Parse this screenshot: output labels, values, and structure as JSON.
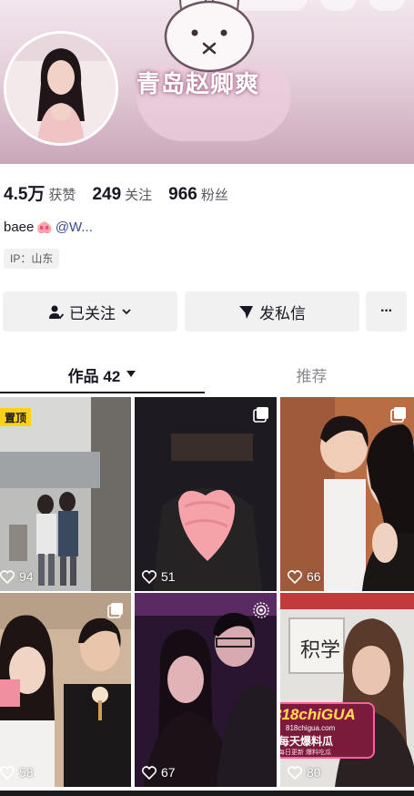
{
  "profile": {
    "nickname": "青岛赵卿爽",
    "stats": [
      {
        "value": "4.5万",
        "label": "获赞"
      },
      {
        "value": "249",
        "label": "关注"
      },
      {
        "value": "966",
        "label": "粉丝"
      }
    ],
    "bio_text": "baee",
    "bio_emoji": "🐽",
    "bio_mention": "@W...",
    "ip_tag": "IP：山东"
  },
  "actions": {
    "follow_label": "已关注",
    "message_label": "发私信",
    "more_label": "···"
  },
  "tabs": {
    "works_label": "作品 42",
    "recommend_label": "推荐"
  },
  "posts": [
    {
      "likes": "94",
      "badge": "置顶"
    },
    {
      "likes": "51"
    },
    {
      "likes": "66"
    },
    {
      "likes": "58"
    },
    {
      "likes": "67"
    },
    {
      "likes": "80"
    }
  ],
  "sticker": {
    "brand": "818chiGUA",
    "site": "818chigua.com",
    "slogan": "每天爆料瓜",
    "tagline": "每日更新 爆料吃瓜"
  },
  "colors": {
    "banner_top": "#f2e6ed",
    "banner_bottom": "#c9a7b9",
    "pin_badge": "#fcd116",
    "button_bg": "#f1f1f2"
  },
  "icons": [
    "follow-person-icon",
    "chevron-down-icon",
    "send-icon",
    "more-icon",
    "heart-icon",
    "multi-image-icon",
    "live-photo-icon"
  ]
}
